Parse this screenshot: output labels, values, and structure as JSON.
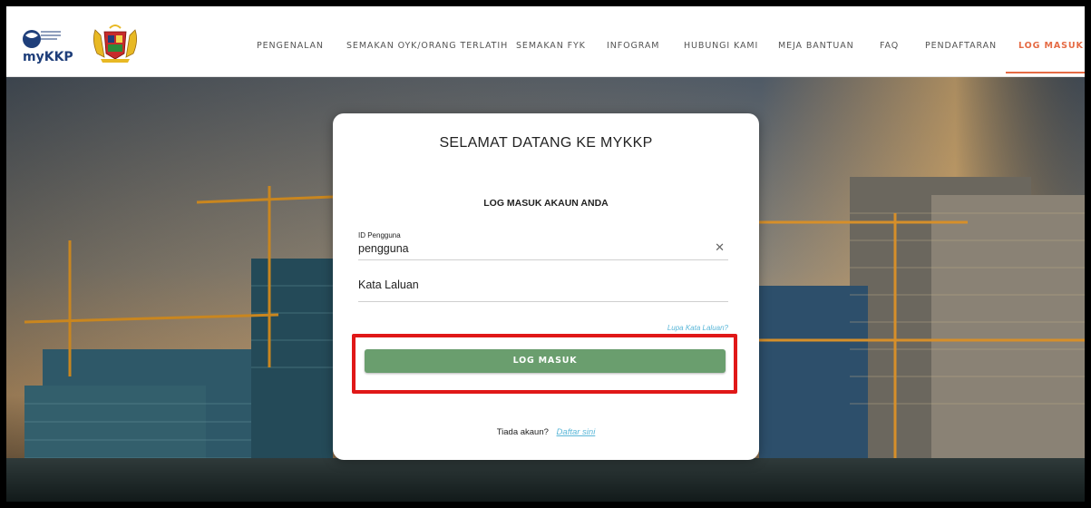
{
  "header": {
    "logo_text": "myKKP",
    "nav": [
      {
        "label": "PENGENALAN",
        "active": false
      },
      {
        "label": "SEMAKAN OYK/ORANG TERLATIH",
        "active": false
      },
      {
        "label": "SEMAKAN FYK",
        "active": false
      },
      {
        "label": "INFOGRAM",
        "active": false
      },
      {
        "label": "HUBUNGI KAMI",
        "active": false
      },
      {
        "label": "MEJA BANTUAN",
        "active": false
      },
      {
        "label": "FAQ",
        "active": false
      },
      {
        "label": "PENDAFTARAN",
        "active": false
      },
      {
        "label": "LOG MASUK",
        "active": true
      }
    ]
  },
  "login": {
    "title": "SELAMAT DATANG KE MYKKP",
    "subtitle": "LOG MASUK AKAUN ANDA",
    "userid_label": "ID Pengguna",
    "userid_value": "pengguna",
    "password_placeholder": "Kata Laluan",
    "forgot_link": "Lupa Kata Laluan?",
    "submit_label": "LOG MASUK",
    "no_account_text": "Tiada akaun?",
    "signup_link": "Daftar sini"
  },
  "colors": {
    "accent": "#e56b45",
    "button": "#6a9e6e",
    "link": "#5bb7d8",
    "highlight": "#e01818"
  }
}
